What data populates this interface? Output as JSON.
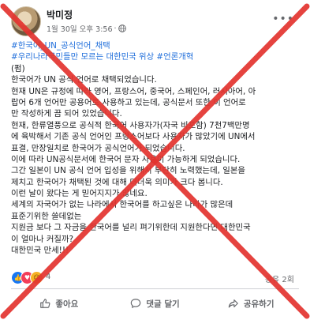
{
  "post": {
    "author": "박미정",
    "timestamp": "1월 30일 오후 3:56",
    "lines": [
      {
        "text": "#한국어_UN_공식언어_채택",
        "kind": "hashtag"
      },
      {
        "text": "#우리나라국민들만 모르는 대한민국 위상 #언론개혁",
        "kind": "hashtag"
      },
      {
        "text": "(펌)",
        "kind": "text"
      },
      {
        "text": "한국어가 UN 공식 언어로 채택되었습니다.",
        "kind": "text"
      },
      {
        "text": "현재 UN은 규정에 따라 영어, 프랑스어, 중국어, 스페인어, 러시아어, 아",
        "kind": "text"
      },
      {
        "text": "랍어 6개 언어만 공용어로 사용하고 있는데, 공식문서 또한 이 언어로",
        "kind": "text"
      },
      {
        "text": "만 작성하게 끔 되어 있었습니다.",
        "kind": "text"
      },
      {
        "text": "현재, 한류열풍으로 공식적 한국어 사용자가(자국 비포함) 7천7백만명",
        "kind": "text"
      },
      {
        "text": "에 육박해서 기존 공식 언어인 프랑스어보다 사용자가 많았기에 UN에서",
        "kind": "text"
      },
      {
        "text": "표결, 만장일치로 한국어가 공식언어가 되었습니다.",
        "kind": "text"
      },
      {
        "text": "이에 따라 UN공식문서에 한국어 문자 사용이 가능하게 되었습니다.",
        "kind": "text"
      },
      {
        "text": "그간 일본이 UN 공식 언어 입성을 위해서 부단히 노력했는데, 일본을",
        "kind": "text"
      },
      {
        "text": "제치고 한국어가 채택된 것에 대해 더더욱 의미가 크다 봅니다.",
        "kind": "text"
      },
      {
        "text": "이런 날이 왔다는 게 믿어지지가 않네요.",
        "kind": "text"
      },
      {
        "text": "세계의 자국어가 없는 나라에서 한국어를 하고싶은 나라가 많은데",
        "kind": "text"
      },
      {
        "text": "표준기위한 쓸데없는",
        "kind": "text"
      },
      {
        "text": "지원금 보다 그 자금을 한국어를 널리 펴기위한데 지원한다면 대한민국",
        "kind": "text"
      },
      {
        "text": "이 얼마나 커질까?",
        "kind": "text"
      },
      {
        "text": "대한민국 만세!!!",
        "kind": "text"
      }
    ]
  },
  "reactions": {
    "count": "4",
    "shares": "공유 2회",
    "icons": [
      "like-icon",
      "love-icon",
      "care-icon"
    ]
  },
  "actions": {
    "like": "좋아요",
    "comment": "댓글 달기",
    "share": "공유하기"
  },
  "colors": {
    "overlay_x": "#e3342f",
    "hashtag": "#216fdb",
    "like_blue": "#1877f2"
  }
}
